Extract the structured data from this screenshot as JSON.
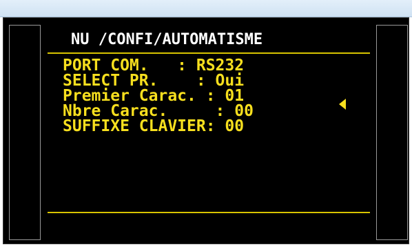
{
  "screen": {
    "title": "NU /CONFI/AUTOMATISME",
    "lines": [
      "PORT COM.   : RS232",
      "SELECT PR.    : Oui",
      "Premier Carac. : 01",
      "Nbre Carac.     : 00",
      "SUFFIXE CLAVIER: 00"
    ],
    "selection_marker": "left-triangle-icon"
  },
  "colors": {
    "background": "#000000",
    "text": "#f7df1e",
    "title": "#ffffff",
    "rule": "#d8c400"
  }
}
